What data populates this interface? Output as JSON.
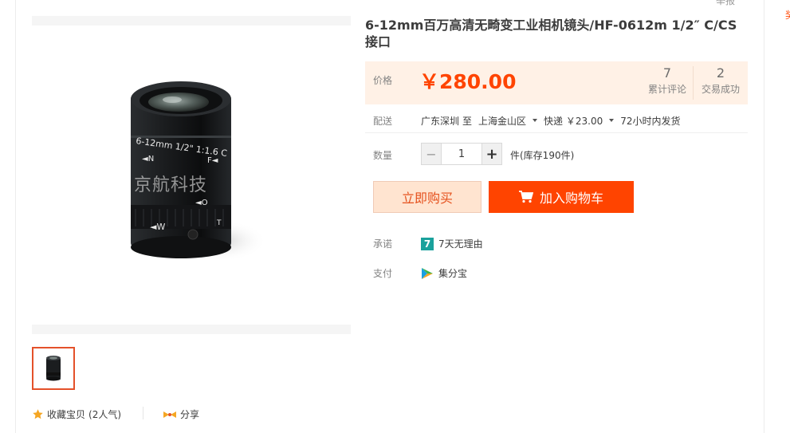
{
  "header": {
    "report_label": "举报",
    "side_char": "奖"
  },
  "gallery": {
    "watermark": "京航科技",
    "main_image_icon": "camera-lens-image",
    "thumbnail_icon": "camera-lens-thumbnail"
  },
  "product": {
    "title": "6-12mm百万高清无畸变工业相机镜头/HF-0612m 1/2″ C/CS接口"
  },
  "price": {
    "label": "价格",
    "value": "￥280.00",
    "reviews_count": "7",
    "reviews_label": "累计评论",
    "trades_count": "2",
    "trades_label": "交易成功",
    "color": "#ff4400"
  },
  "delivery": {
    "label": "配送",
    "from": "广东深圳",
    "to_word": "至",
    "destination": "上海金山区",
    "shipping": "快递 ￥23.00",
    "ship_time": "72小时内发货"
  },
  "quantity": {
    "label": "数量",
    "minus": "−",
    "value": "1",
    "plus": "+",
    "stock": "件(库存190件)"
  },
  "actions": {
    "buy_now": "立即购买",
    "add_to_cart": "加入购物车"
  },
  "promise": {
    "label": "承诺",
    "badge": "7",
    "text": "7天无理由"
  },
  "payment": {
    "label": "支付",
    "text": "集分宝"
  },
  "footer": {
    "collect_text": "收藏宝贝",
    "collect_count": "(2人气)",
    "share_text": "分享"
  }
}
